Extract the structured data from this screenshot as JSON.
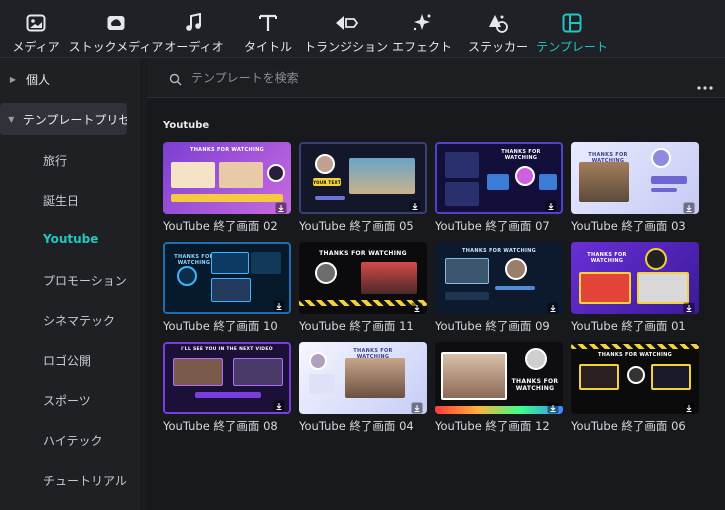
{
  "toolbar": {
    "items": [
      {
        "label": "メディア",
        "icon": "media-icon"
      },
      {
        "label": "ストックメディア",
        "icon": "stock-media-icon"
      },
      {
        "label": "オーディオ",
        "icon": "audio-note-icon"
      },
      {
        "label": "タイトル",
        "icon": "title-T-icon"
      },
      {
        "label": "トランジション",
        "icon": "transition-icon"
      },
      {
        "label": "エフェクト",
        "icon": "effect-sparkle-icon"
      },
      {
        "label": "ステッカー",
        "icon": "sticker-icon"
      },
      {
        "label": "テンプレート",
        "icon": "template-icon",
        "active": true
      }
    ]
  },
  "sidebar": {
    "groups": [
      {
        "label": "個人",
        "expanded": false
      },
      {
        "label": "テンプレートプリセ...",
        "expanded": true
      }
    ],
    "items": [
      "旅行",
      "誕生日",
      "Youtube",
      "プロモーション",
      "シネマテック",
      "ロゴ公開",
      "スポーツ",
      "ハイテック",
      "チュートリアル"
    ],
    "active_item": "Youtube"
  },
  "search": {
    "placeholder": "テンプレートを検索",
    "value": ""
  },
  "section": {
    "title": "Youtube"
  },
  "templates": [
    {
      "name": "YouTube 終了画面 02",
      "thumb_text": "THANKS FOR WATCHING"
    },
    {
      "name": "YouTube 終了画面 05",
      "thumb_text": "YOUR TEXT"
    },
    {
      "name": "YouTube 終了画面 07",
      "thumb_text": "THANKS FOR WATCHING"
    },
    {
      "name": "YouTube 終了画面 03",
      "thumb_text": "THANKS FOR WATCHING"
    },
    {
      "name": "YouTube 終了画面 10",
      "thumb_text": "THANKS FOR WATCHING"
    },
    {
      "name": "YouTube 終了画面 11",
      "thumb_text": "THANKS FOR WATCHING"
    },
    {
      "name": "YouTube 終了画面 09",
      "thumb_text": "THANKS FOR WATCHING"
    },
    {
      "name": "YouTube 終了画面 01",
      "thumb_text": "THANKS FOR WATCHING"
    },
    {
      "name": "YouTube 終了画面 08",
      "thumb_text": "I'LL SEE YOU IN THE NEXT VIDEO"
    },
    {
      "name": "YouTube 終了画面 04",
      "thumb_text": "THANKS FOR WATCHING"
    },
    {
      "name": "YouTube 終了画面 12",
      "thumb_text": "THANKS FOR WATCHING"
    },
    {
      "name": "YouTube 終了画面 06",
      "thumb_text": "THANKS FOR WATCHING"
    }
  ],
  "colors": {
    "accent": "#1fc7c0",
    "background": "#17191d",
    "panel": "#1e2024"
  }
}
